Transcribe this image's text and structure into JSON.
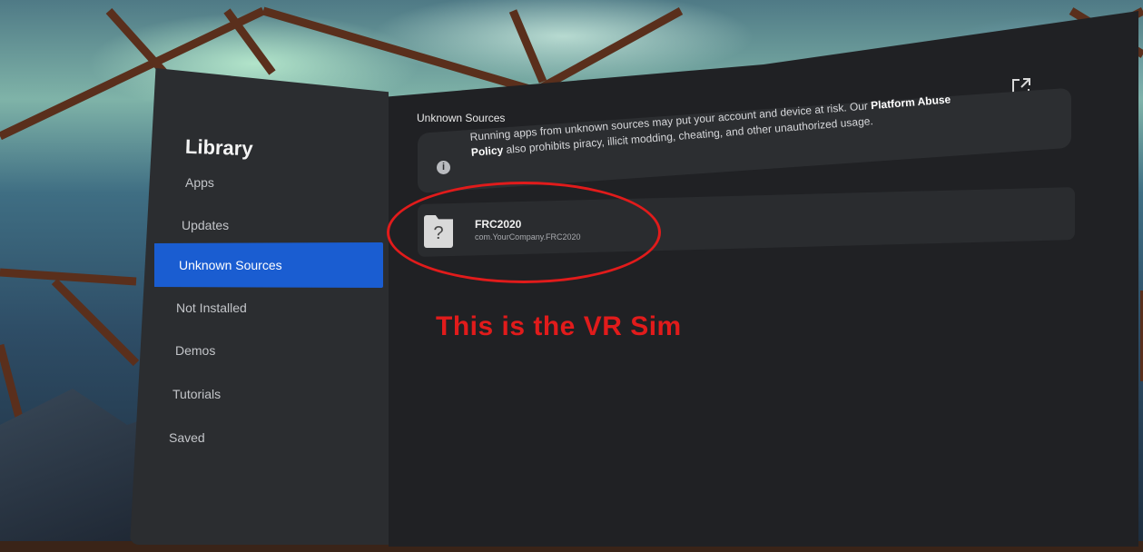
{
  "sidebar": {
    "title": "Library",
    "items": [
      {
        "label": "Apps",
        "active": false
      },
      {
        "label": "Updates",
        "active": false
      },
      {
        "label": "Unknown Sources",
        "active": true
      },
      {
        "label": "Not Installed",
        "active": false
      },
      {
        "label": "Demos",
        "active": false
      },
      {
        "label": "Tutorials",
        "active": false
      },
      {
        "label": "Saved",
        "active": false
      }
    ]
  },
  "main": {
    "section_title": "Unknown Sources",
    "open_external_icon": "external-link-icon",
    "notice": {
      "icon": "info-icon",
      "text_before": "Running apps from unknown sources may put your account and device at risk. Our ",
      "link_text": "Platform Abuse Policy",
      "text_after": " also prohibits piracy, illicit modding, cheating, and other unauthorized usage."
    },
    "apps": [
      {
        "name": "FRC2020",
        "package": "com.YourCompany.FRC2020",
        "icon": "unknown-app-icon",
        "icon_glyph": "?"
      }
    ]
  },
  "annotation": {
    "text": "This is the VR Sim",
    "color": "#e11b1b"
  },
  "colors": {
    "accent": "#1a5dd1",
    "panel": "#202124",
    "sidebar": "#2b2d30"
  }
}
